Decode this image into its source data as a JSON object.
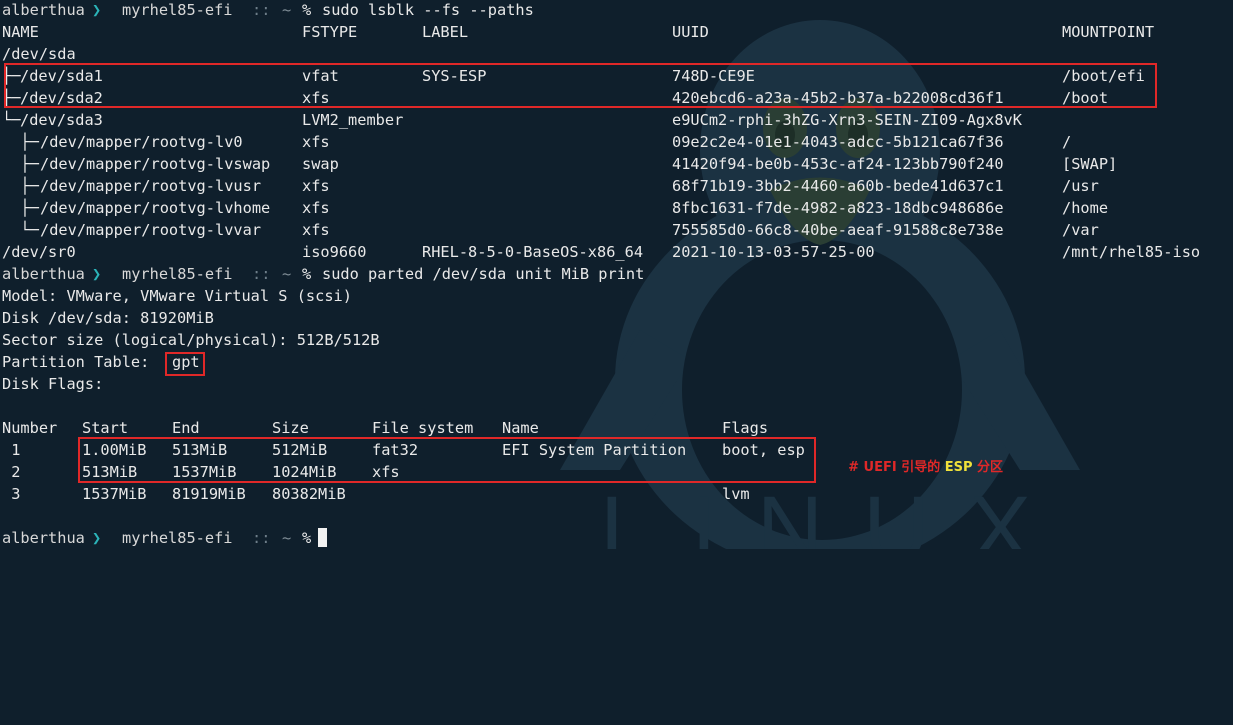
{
  "prompt": {
    "user": "alberthua",
    "arrow": "❯",
    "host": "myrhel85-efi",
    "sep": "::",
    "dir": "~",
    "symbol": "%"
  },
  "commands": {
    "lsblk": "sudo lsblk --fs --paths",
    "parted": "sudo parted /dev/sda unit MiB print"
  },
  "lsblk": {
    "headers": [
      "NAME",
      "FSTYPE",
      "LABEL",
      "UUID",
      "MOUNTPOINT"
    ],
    "rows": [
      {
        "tree": "",
        "name": "/dev/sda",
        "fstype": "",
        "label": "",
        "uuid": "",
        "mount": ""
      },
      {
        "tree": "├─",
        "name": "/dev/sda1",
        "fstype": "vfat",
        "label": "SYS-ESP",
        "uuid": "748D-CE9E",
        "mount": "/boot/efi"
      },
      {
        "tree": "├─",
        "name": "/dev/sda2",
        "fstype": "xfs",
        "label": "",
        "uuid": "420ebcd6-a23a-45b2-b37a-b22008cd36f1",
        "mount": "/boot"
      },
      {
        "tree": "└─",
        "name": "/dev/sda3",
        "fstype": "LVM2_member",
        "label": "",
        "uuid": "e9UCm2-rphi-3hZG-Xrn3-SEIN-ZI09-Agx8vK",
        "mount": ""
      },
      {
        "tree": "  ├─",
        "name": "/dev/mapper/rootvg-lv0",
        "fstype": "xfs",
        "label": "",
        "uuid": "09e2c2e4-01e1-4043-adcc-5b121ca67f36",
        "mount": "/"
      },
      {
        "tree": "  ├─",
        "name": "/dev/mapper/rootvg-lvswap",
        "fstype": "swap",
        "label": "",
        "uuid": "41420f94-be0b-453c-af24-123bb790f240",
        "mount": "[SWAP]"
      },
      {
        "tree": "  ├─",
        "name": "/dev/mapper/rootvg-lvusr",
        "fstype": "xfs",
        "label": "",
        "uuid": "68f71b19-3bb2-4460-a60b-bede41d637c1",
        "mount": "/usr"
      },
      {
        "tree": "  ├─",
        "name": "/dev/mapper/rootvg-lvhome",
        "fstype": "xfs",
        "label": "",
        "uuid": "8fbc1631-f7de-4982-a823-18dbc948686e",
        "mount": "/home"
      },
      {
        "tree": "  └─",
        "name": "/dev/mapper/rootvg-lvvar",
        "fstype": "xfs",
        "label": "",
        "uuid": "755585d0-66c8-40be-aeaf-91588c8e738e",
        "mount": "/var"
      },
      {
        "tree": "",
        "name": "/dev/sr0",
        "fstype": "iso9660",
        "label": "RHEL-8-5-0-BaseOS-x86_64",
        "uuid": "2021-10-13-03-57-25-00",
        "mount": "/mnt/rhel85-iso"
      }
    ]
  },
  "parted": {
    "model": "Model: VMware, VMware Virtual S (scsi)",
    "disk": "Disk /dev/sda: 81920MiB",
    "sector": "Sector size (logical/physical): 512B/512B",
    "pt_label": "Partition Table: ",
    "pt_value": "gpt",
    "flags": "Disk Flags:",
    "headers": [
      "Number",
      "Start",
      "End",
      "Size",
      "File system",
      "Name",
      "Flags"
    ],
    "rows": [
      {
        "num": " 1",
        "start": "1.00MiB",
        "end": "513MiB",
        "size": "512MiB",
        "fs": "fat32",
        "name": "EFI System Partition",
        "flags": "boot, esp"
      },
      {
        "num": " 2",
        "start": "513MiB",
        "end": "1537MiB",
        "size": "1024MiB",
        "fs": "xfs",
        "name": "",
        "flags": ""
      },
      {
        "num": " 3",
        "start": "1537MiB",
        "end": "81919MiB",
        "size": "80382MiB",
        "fs": "",
        "name": "",
        "flags": "lvm"
      }
    ]
  },
  "annotation": {
    "prefix": "# UEFI 引导的 ",
    "highlight": "ESP",
    "suffix": " 分区"
  },
  "watermark": {
    "text": "LINUX"
  },
  "colors": {
    "background": "#0f1f2c",
    "text": "#e9e9e9",
    "accent_red": "#e02828",
    "prompt_arrow": "#2bb3b8",
    "highlight_yellow": "#f0e13a"
  }
}
